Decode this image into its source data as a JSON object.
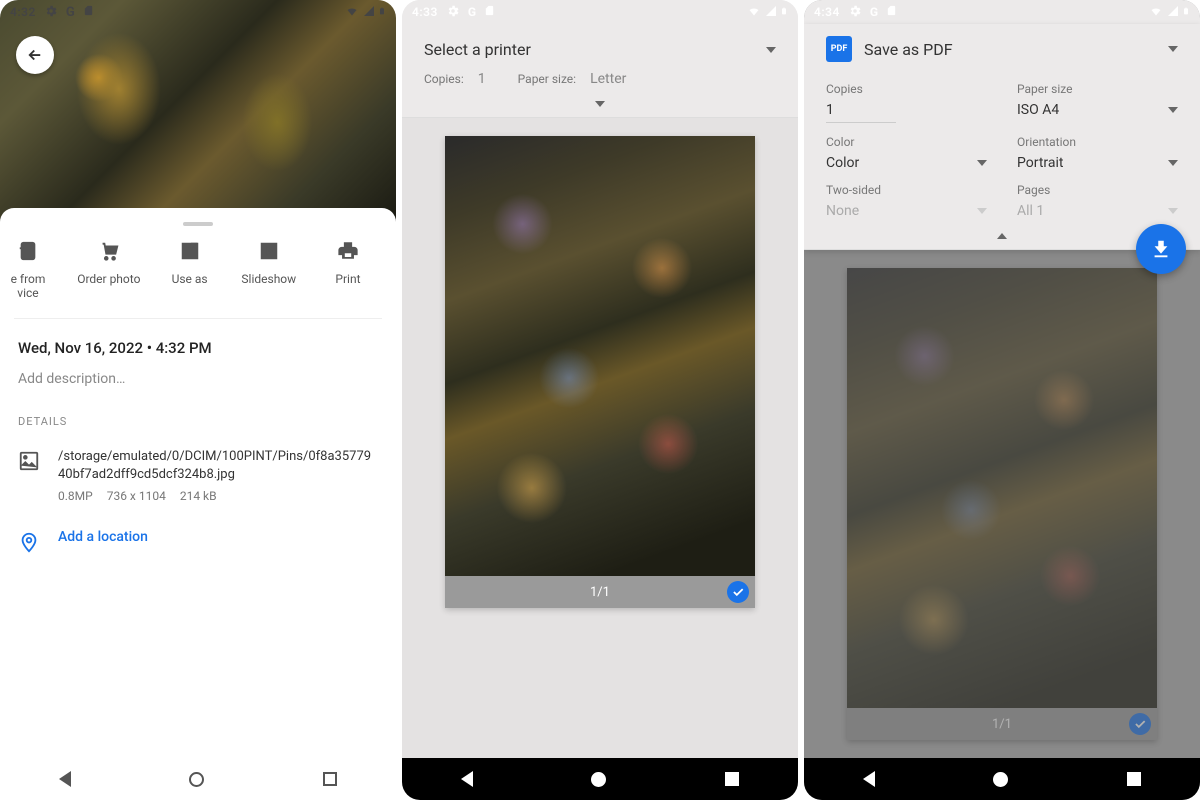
{
  "phone1": {
    "statusbar": {
      "time": "4:32"
    },
    "actions": [
      {
        "label": "e from\nvice"
      },
      {
        "label": "Order photo"
      },
      {
        "label": "Use as"
      },
      {
        "label": "Slideshow"
      },
      {
        "label": "Print"
      }
    ],
    "datetime": "Wed, Nov 16, 2022  •  4:32 PM",
    "description_placeholder": "Add description…",
    "details_header": "DETAILS",
    "file_path": "/storage/emulated/0/DCIM/100PINT/Pins/0f8a3577940bf7ad2dff9cd5dcf324b8.jpg",
    "file_mp": "0.8MP",
    "file_dims": "736 x 1104",
    "file_size": "214 kB",
    "add_location": "Add a location"
  },
  "phone2": {
    "statusbar": {
      "time": "4:33"
    },
    "title": "Select a printer",
    "copies_label": "Copies:",
    "copies_value": "1",
    "paper_label": "Paper size:",
    "paper_value": "Letter",
    "page_counter": "1/1"
  },
  "phone3": {
    "statusbar": {
      "time": "4:34"
    },
    "title": "Save as PDF",
    "options": {
      "copies_label": "Copies",
      "copies_value": "1",
      "paper_label": "Paper size",
      "paper_value": "ISO A4",
      "color_label": "Color",
      "color_value": "Color",
      "orient_label": "Orientation",
      "orient_value": "Portrait",
      "twosided_label": "Two-sided",
      "twosided_value": "None",
      "pages_label": "Pages",
      "pages_value": "All 1"
    },
    "page_counter": "1/1"
  }
}
